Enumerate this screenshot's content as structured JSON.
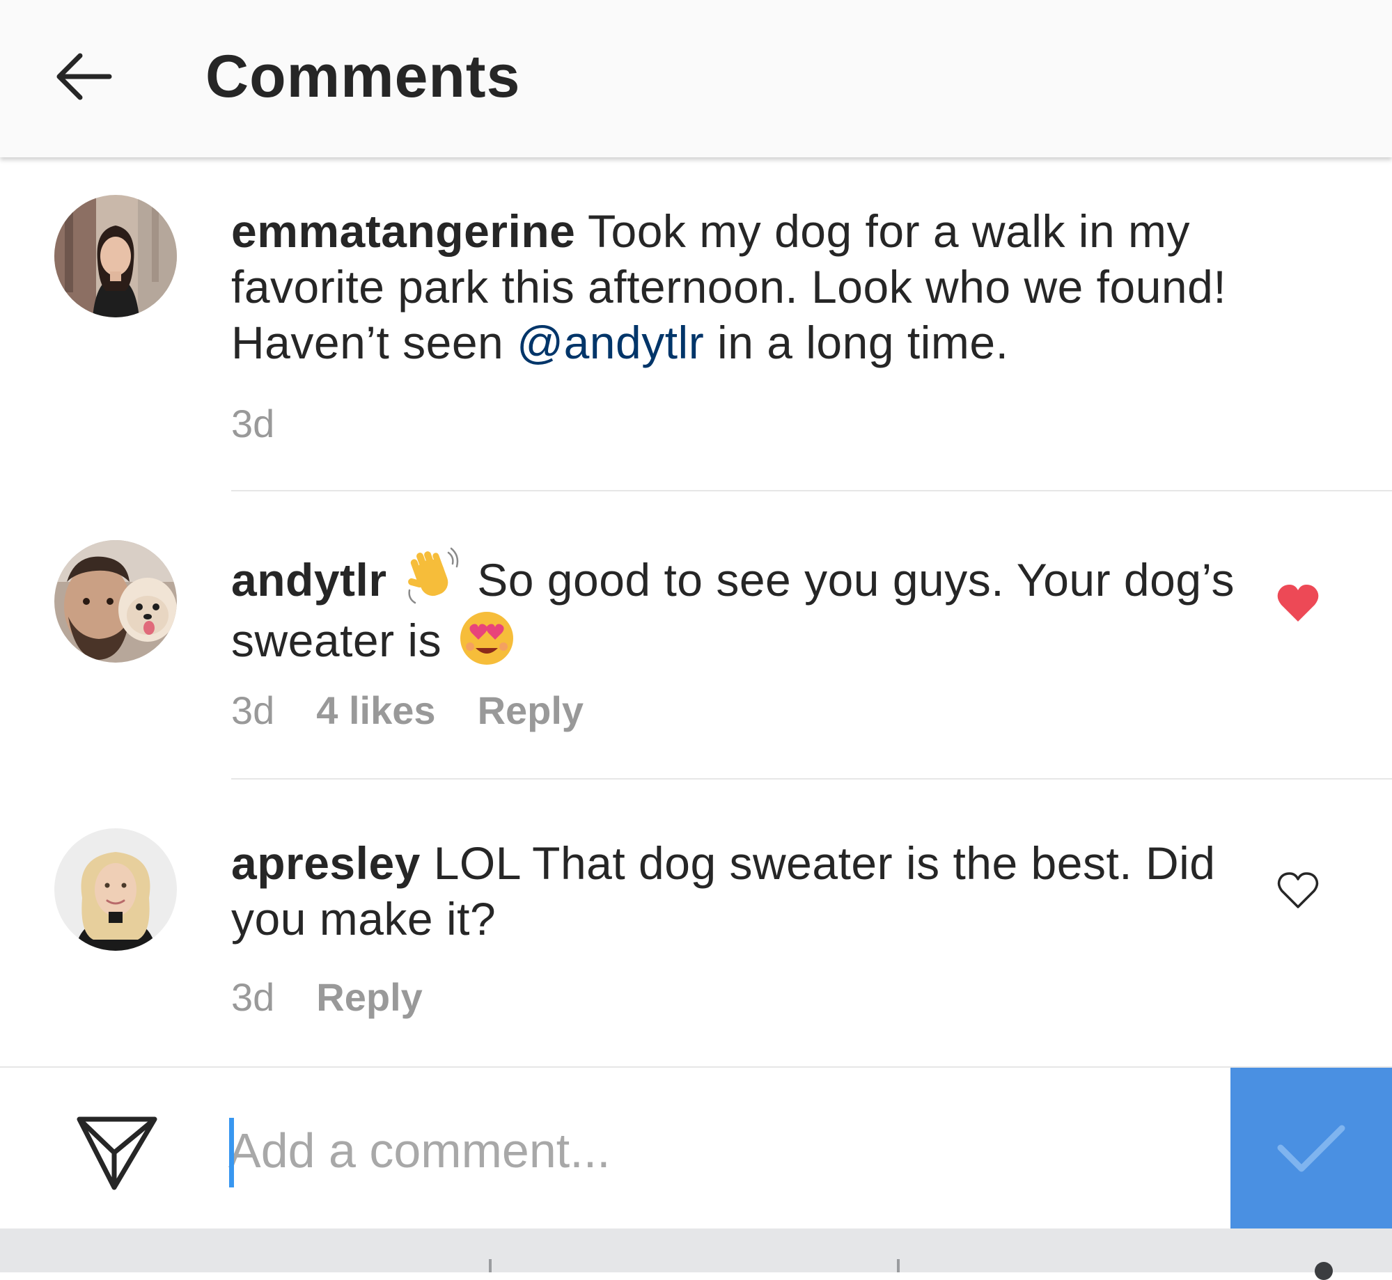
{
  "header": {
    "title": "Comments",
    "back_icon": "arrow-left-icon"
  },
  "comments": [
    {
      "username": "emmatangerine",
      "text_before_mention": " Took my dog for a walk in my favorite park this afternoon. Look who we found! Haven’t seen ",
      "mention": "@andytlr",
      "text_after_mention": " in a long time.",
      "time": "3d",
      "avatar_icon": "avatar-emmatangerine"
    },
    {
      "username": "andytlr",
      "emoji_1": "waving-hand-emoji",
      "text_middle": " So good to see you guys. Your dog’s sweater is ",
      "emoji_2": "heart-eyes-emoji",
      "time": "3d",
      "likes": "4 likes",
      "reply": "Reply",
      "liked": true,
      "heart_color": "#ed4956",
      "avatar_icon": "avatar-andytlr"
    },
    {
      "username": "apresley",
      "text": " LOL That dog sweater is the best. Did you make it?",
      "time": "3d",
      "reply": "Reply",
      "liked": false,
      "avatar_icon": "avatar-apresley"
    }
  ],
  "composer": {
    "placeholder": "Add a comment...",
    "value": "",
    "send_icon": "paper-plane-icon",
    "post_icon": "checkmark-icon",
    "post_button_color": "#4a90e2"
  },
  "colors": {
    "text": "#262626",
    "secondary": "#999999",
    "mention": "#003569",
    "header_bg": "#fafafa"
  }
}
